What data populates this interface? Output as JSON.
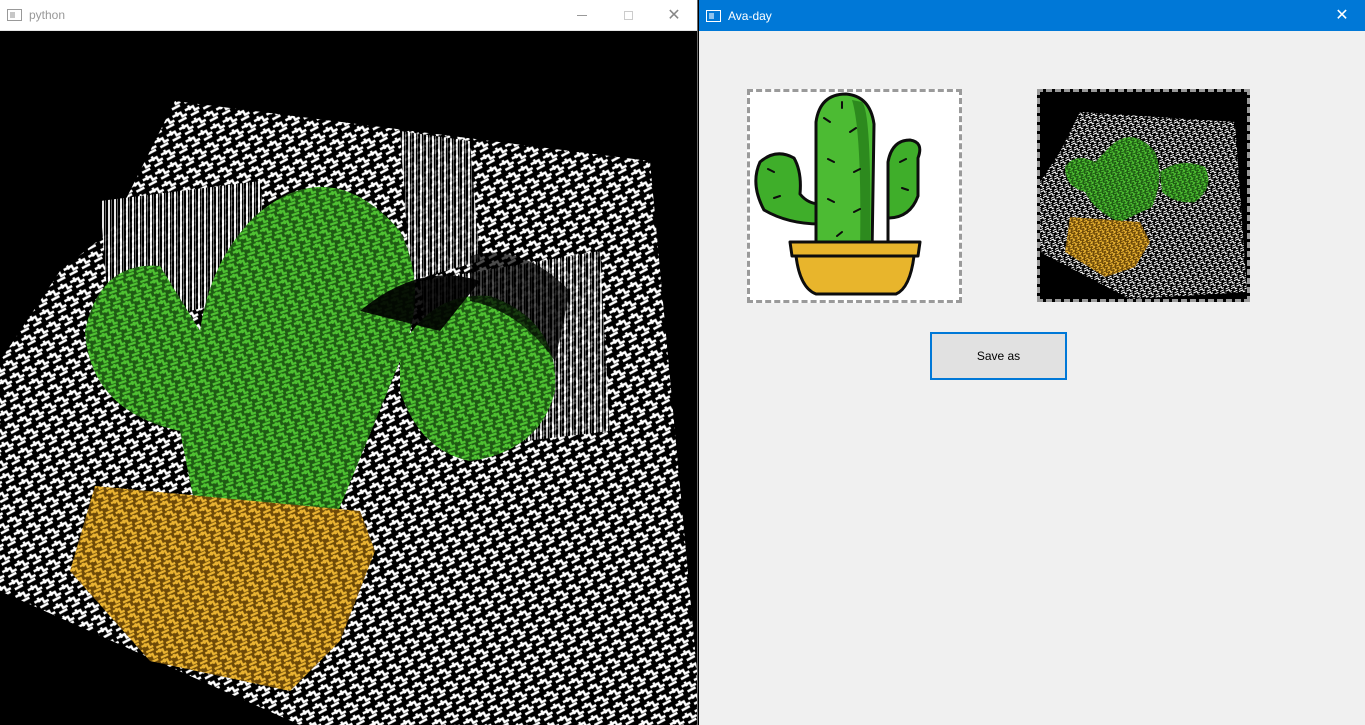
{
  "python_window": {
    "title": "python",
    "controls": {
      "minimize": "minimize-icon",
      "maximize": "maximize-icon",
      "close": "close-icon"
    }
  },
  "ava_window": {
    "title": "Ava-day",
    "controls": {
      "close": "close-icon"
    },
    "source_image": {
      "subject": "cactus in yellow pot"
    },
    "output_image": {
      "subject": "3D relief render of cactus"
    },
    "save_button_label": "Save as"
  },
  "colors": {
    "accent": "#0078d7",
    "cactus_green": "#3fae2a",
    "pot_yellow": "#e8b52c",
    "window_bg": "#f0f0f0"
  }
}
